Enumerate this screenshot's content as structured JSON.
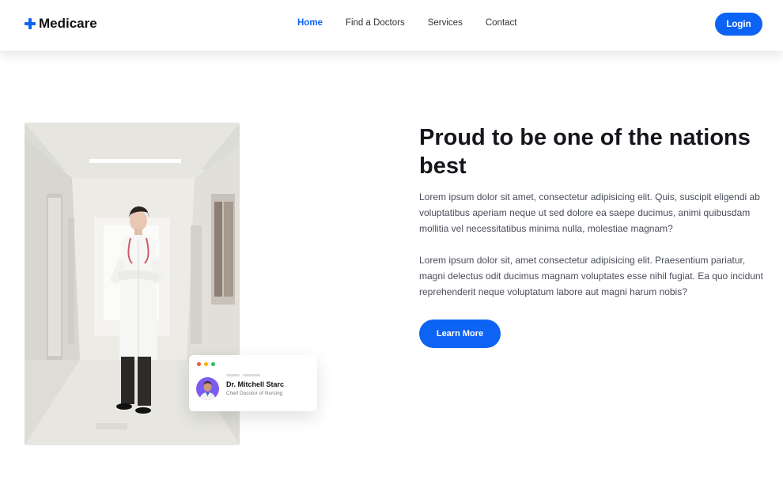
{
  "brand": {
    "name": "Medicare",
    "icon": "plus-cross-icon",
    "color": "#0d63f3"
  },
  "nav": {
    "links": [
      {
        "label": "Home",
        "active": true
      },
      {
        "label": "Find a Doctors",
        "active": false
      },
      {
        "label": "Services",
        "active": false
      },
      {
        "label": "Contact",
        "active": false
      }
    ],
    "login_label": "Login"
  },
  "hero": {
    "heading": "Proud to be one of the nations best",
    "paragraph_1": "Lorem ipsum dolor sit amet, consectetur adipisicing elit. Quis, suscipit eligendi ab voluptatibus aperiam neque ut sed dolore ea saepe ducimus, animi quibusdam mollitia vel necessitatibus minima nulla, molestiae magnam?",
    "paragraph_2": "Lorem ipsum dolor sit, amet consectetur adipisicing elit. Praesentium pariatur, magni delectus odit ducimus magnam voluptates esse nihil fugiat. Ea quo incidunt reprehenderit neque voluptatum labore aut magni harum nobis?",
    "cta_label": "Learn More"
  },
  "doctor_card": {
    "name": "Dr. Mitchell Starc",
    "role": "Cheif Docotor of Nursing",
    "dot_colors": [
      "#f0553c",
      "#f5b300",
      "#2cbf5a"
    ]
  },
  "colors": {
    "accent": "#0d63f3",
    "avatar_bg": "#7b5cf0"
  }
}
